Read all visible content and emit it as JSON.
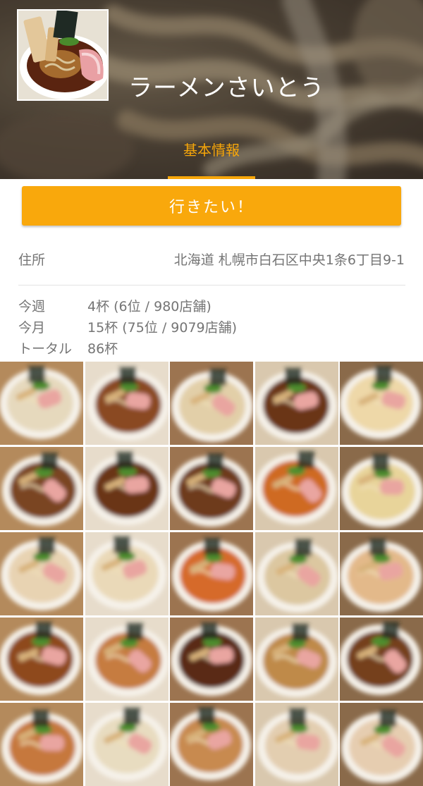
{
  "header": {
    "shop_name": "ラーメンさいとう",
    "tabs": [
      {
        "label": "基本情報",
        "active": true
      }
    ]
  },
  "actions": {
    "want_to_go_label": "行きたい！"
  },
  "info": {
    "address_label": "住所",
    "address_value": "北海道 札幌市白石区中央1条6丁目9-1",
    "stats": [
      {
        "label": "今週",
        "value": "4杯 (6位 / 980店舗)"
      },
      {
        "label": "今月",
        "value": "15杯 (75位 / 9079店舗)"
      },
      {
        "label": "トータル",
        "value": "86杯"
      }
    ]
  },
  "gallery": {
    "tile_soups": [
      "#e6d9bd",
      "#8a4a22",
      "#e2cfa8",
      "#6b3418",
      "#eed8a8",
      "#7a4424",
      "#6a3618",
      "#6e3a1c",
      "#cf6a22",
      "#e8d49a",
      "#e8d3b2",
      "#ead9b8",
      "#d66b2a",
      "#dcc7a0",
      "#e3b98a",
      "#8e4a1e",
      "#c67b40",
      "#5a2a14",
      "#bf8a4a",
      "#74401e",
      "#c6783c",
      "#e8dcc0",
      "#c88a50",
      "#e3ceb0",
      "#e6cdb0"
    ]
  },
  "colors": {
    "accent": "#f6a60a",
    "button_bg": "#f9a80c",
    "button_text": "#ffffff",
    "info_text": "#757575",
    "divider": "#e2e2e2"
  }
}
